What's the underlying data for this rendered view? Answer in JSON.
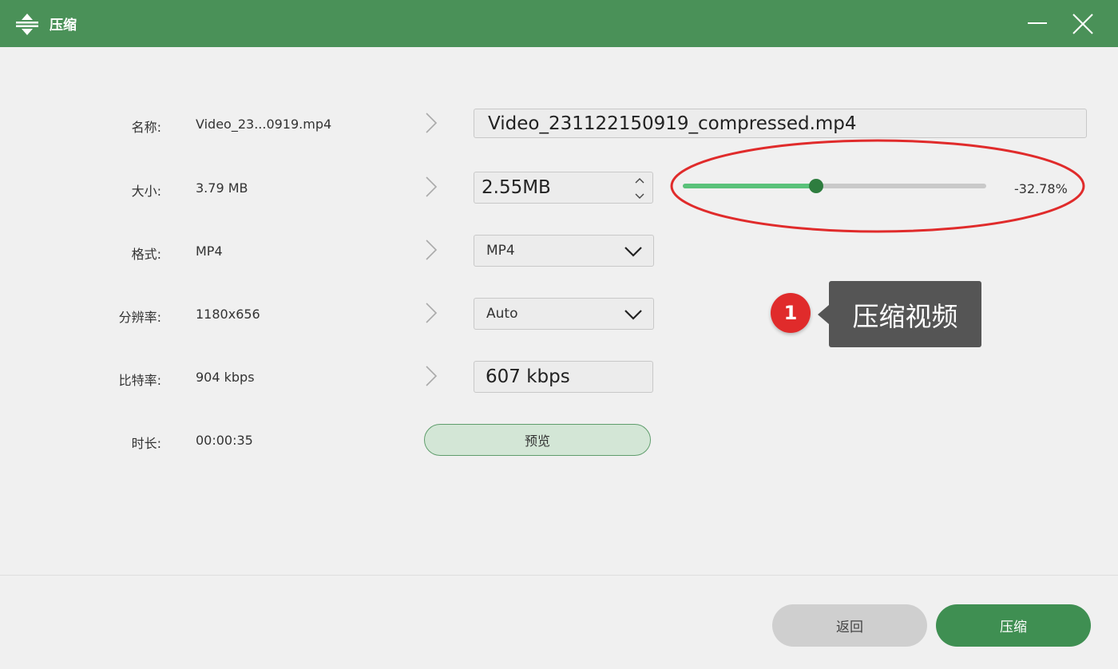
{
  "window": {
    "title": "压缩",
    "title_icon": "compress-icon",
    "minimize_icon": "minimize-icon",
    "close_icon": "close-icon"
  },
  "rows": {
    "name": {
      "label": "名称:",
      "original": "Video_23...0919.mp4",
      "output": "Video_231122150919_compressed.mp4"
    },
    "size": {
      "label": "大小:",
      "original": "3.79 MB",
      "output": "2.55MB"
    },
    "format": {
      "label": "格式:",
      "original": "MP4",
      "selected": "MP4"
    },
    "resolution": {
      "label": "分辨率:",
      "original": "1180x656",
      "selected": "Auto"
    },
    "bitrate": {
      "label": "比特率:",
      "original": "904 kbps",
      "output": "607 kbps"
    },
    "duration": {
      "label": "时长:",
      "original": "00:00:35"
    }
  },
  "slider": {
    "value_fraction": 0.44,
    "percent_label": "-32.78%"
  },
  "preview_button": {
    "label": "预览"
  },
  "annotation": {
    "badge_number": "1",
    "callout_text": "压缩视频"
  },
  "footer": {
    "back_label": "返回",
    "compress_label": "压缩"
  },
  "colors": {
    "titlebar": "#4a9158",
    "accent": "#3f8f52",
    "slider_fill": "#5ac27a",
    "slider_thumb": "#2e7d3f",
    "annotation_red": "#e02b2b"
  }
}
